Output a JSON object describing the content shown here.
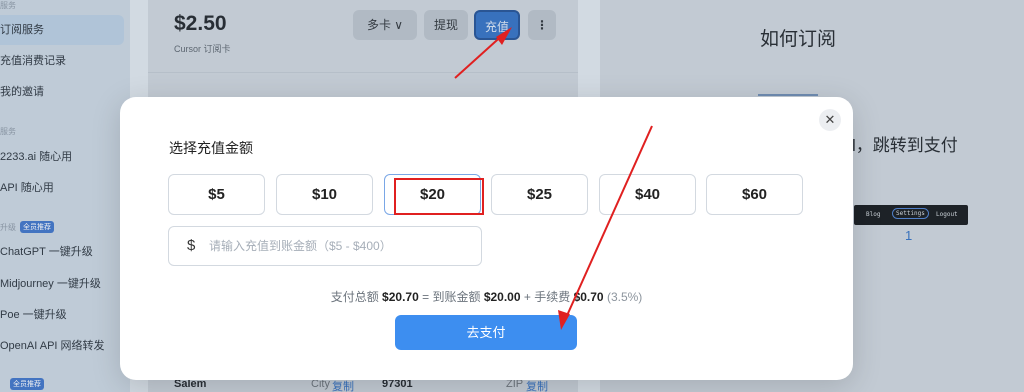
{
  "sidebar": {
    "section1": "服务",
    "items1": [
      {
        "label": "订阅服务",
        "active": true
      },
      {
        "label": "充值消费记录"
      },
      {
        "label": "我的邀请"
      }
    ],
    "section2": "服务",
    "items2": [
      {
        "label": "2233.ai 随心用"
      },
      {
        "label": "API 随心用"
      }
    ],
    "section3": "升级",
    "tag": "全员推荐",
    "items3": [
      {
        "label": "ChatGPT 一键升级"
      },
      {
        "label": "Midjourney 一键升级"
      },
      {
        "label": "Poe 一键升级"
      },
      {
        "label": "OpenAI API 网络转发"
      }
    ],
    "tag2": "全员推荐"
  },
  "card": {
    "balance": "$2.50",
    "subtitle": "Cursor 订阅卡",
    "btn_multi": "多卡 ∨",
    "btn_withdraw": "提现",
    "btn_recharge": "充值",
    "btn_more": "⋮"
  },
  "right": {
    "title": "如何订阅",
    "text": "l，跳转到支付",
    "nav": [
      "Blog",
      "Settings",
      "Logout"
    ],
    "num": "1"
  },
  "bottom": {
    "city_value": "Salem",
    "city_label": "City",
    "copy1": "复制",
    "zip_value": "97301",
    "zip_label": "ZIP",
    "copy2": "复制"
  },
  "modal": {
    "title": "选择充值金额",
    "close_icon": "close-icon",
    "amounts": [
      "$5",
      "$10",
      "$20",
      "$25",
      "$40",
      "$60"
    ],
    "selected": "$20",
    "currency_symbol": "$",
    "input_placeholder": "请输入充值到账金额（$5 - $400）",
    "summary": {
      "total_label": "支付总额",
      "total": "$20.70",
      "eq": "=",
      "received_label": "到账金额",
      "received": "$20.00",
      "plus": "+",
      "fee_label": "手续费",
      "fee": "$0.70",
      "pct": "(3.5%)"
    },
    "pay_button": "去支付"
  },
  "colors": {
    "primary": "#3d8ef0",
    "annotation_red": "#e02020"
  }
}
